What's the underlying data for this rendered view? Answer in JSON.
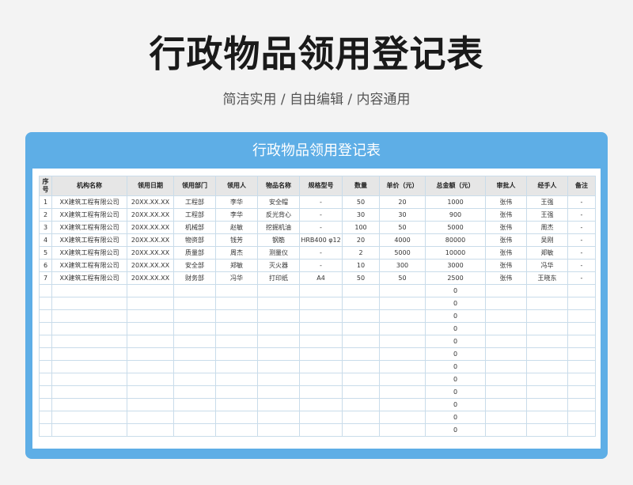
{
  "title": "行政物品领用登记表",
  "subtitle": "简洁实用 / 自由编辑 / 内容通用",
  "card_title": "行政物品领用登记表",
  "headers": [
    "序号",
    "机构名称",
    "领用日期",
    "领用部门",
    "领用人",
    "物品名称",
    "规格型号",
    "数量",
    "单价（元）",
    "总金额（元）",
    "审批人",
    "经手人",
    "备注"
  ],
  "rows": [
    [
      "1",
      "XX建筑工程有限公司",
      "20XX.XX.XX",
      "工程部",
      "李华",
      "安全帽",
      "-",
      "50",
      "20",
      "1000",
      "张伟",
      "王强",
      "-"
    ],
    [
      "2",
      "XX建筑工程有限公司",
      "20XX.XX.XX",
      "工程部",
      "李华",
      "反光背心",
      "-",
      "30",
      "30",
      "900",
      "张伟",
      "王强",
      "-"
    ],
    [
      "3",
      "XX建筑工程有限公司",
      "20XX.XX.XX",
      "机械部",
      "赵敏",
      "挖掘机油",
      "-",
      "100",
      "50",
      "5000",
      "张伟",
      "周杰",
      "-"
    ],
    [
      "4",
      "XX建筑工程有限公司",
      "20XX.XX.XX",
      "物资部",
      "钱芳",
      "钢筋",
      "HRB400 φ12",
      "20",
      "4000",
      "80000",
      "张伟",
      "吴刚",
      "-"
    ],
    [
      "5",
      "XX建筑工程有限公司",
      "20XX.XX.XX",
      "质量部",
      "周杰",
      "测量仪",
      "-",
      "2",
      "5000",
      "10000",
      "张伟",
      "郑敏",
      "-"
    ],
    [
      "6",
      "XX建筑工程有限公司",
      "20XX.XX.XX",
      "安全部",
      "郑敏",
      "灭火器",
      "-",
      "10",
      "300",
      "3000",
      "张伟",
      "冯华",
      "-"
    ],
    [
      "7",
      "XX建筑工程有限公司",
      "20XX.XX.XX",
      "财务部",
      "冯华",
      "打印纸",
      "A4",
      "50",
      "50",
      "2500",
      "张伟",
      "王晓东",
      "-"
    ]
  ],
  "empty_row_total": "0",
  "empty_row_count": 12
}
